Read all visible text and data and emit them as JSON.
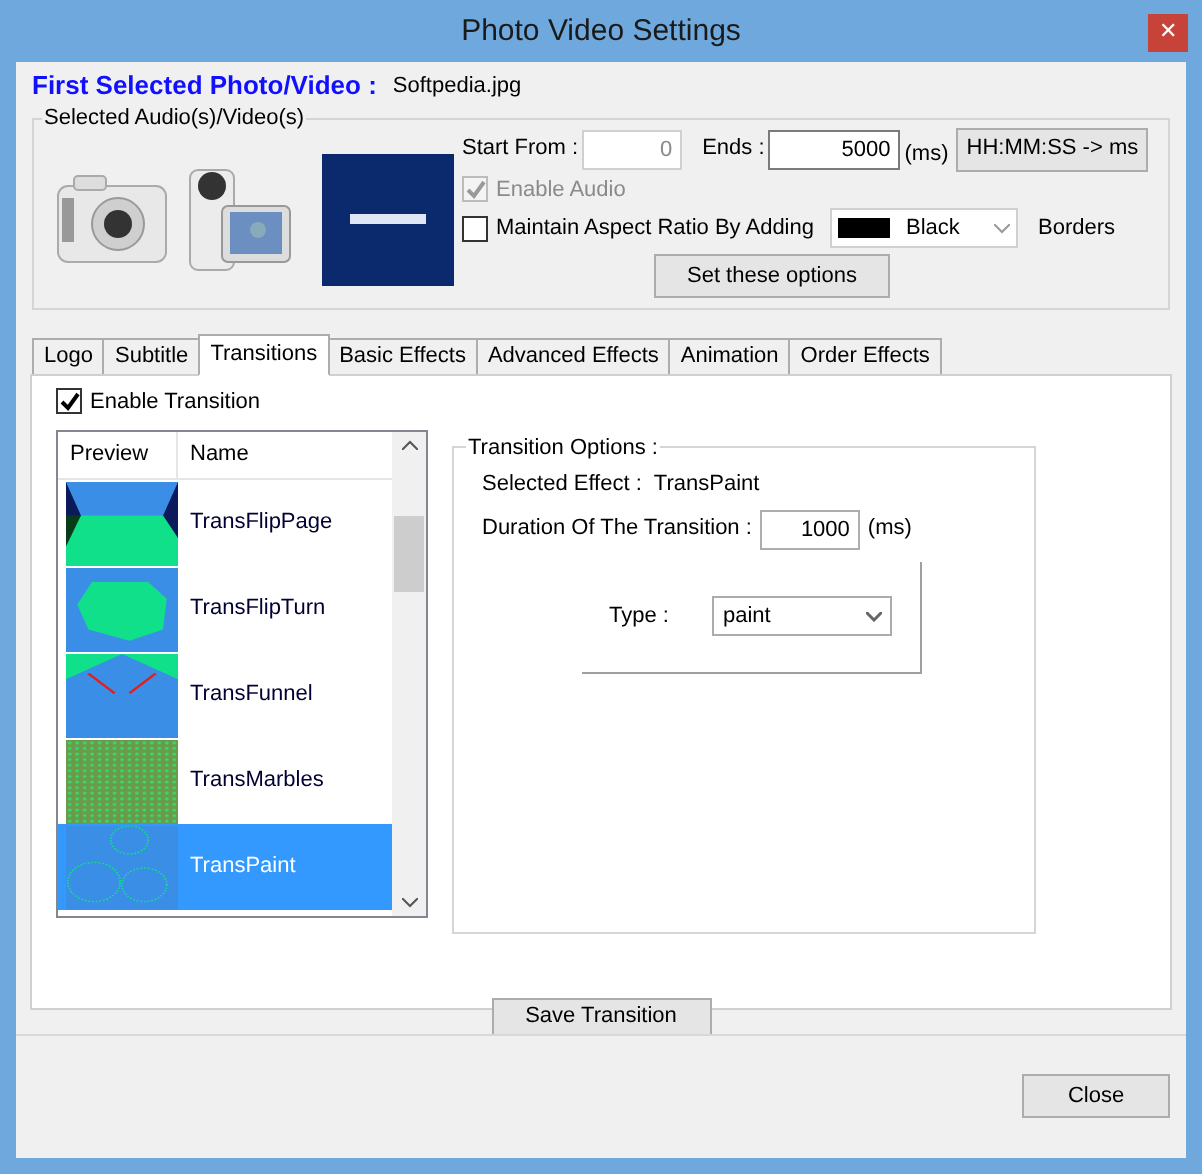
{
  "window": {
    "title": "Photo Video Settings",
    "close": "✕"
  },
  "first_selected": {
    "label": "First Selected Photo/Video :",
    "value": "Softpedia.jpg"
  },
  "media": {
    "legend": "Selected Audio(s)/Video(s)",
    "start_label": "Start From :",
    "start_value": "0",
    "start_disabled": true,
    "ends_label": "Ends :",
    "ends_value": "5000",
    "ends_unit": "(ms)",
    "convert_button": "HH:MM:SS -> ms",
    "enable_audio": {
      "label": "Enable Audio",
      "checked": true,
      "disabled": true
    },
    "aspect": {
      "label": "Maintain Aspect Ratio By Adding",
      "checked": false
    },
    "border_color": {
      "value": "Black",
      "color": "#000000"
    },
    "borders_label": "Borders",
    "set_button": "Set these options"
  },
  "tabs": [
    {
      "label": "Logo",
      "selected": false
    },
    {
      "label": "Subtitle",
      "selected": false
    },
    {
      "label": "Transitions",
      "selected": true
    },
    {
      "label": "Basic Effects",
      "selected": false
    },
    {
      "label": "Advanced Effects",
      "selected": false
    },
    {
      "label": "Animation",
      "selected": false
    },
    {
      "label": "Order Effects",
      "selected": false
    }
  ],
  "enable_transition": {
    "label": "Enable Transition",
    "checked": true
  },
  "list": {
    "columns": [
      "Preview",
      "Name"
    ],
    "rows": [
      {
        "name": "TransFlipPage",
        "kind": "flippage",
        "selected": false
      },
      {
        "name": "TransFlipTurn",
        "kind": "flipturn",
        "selected": false
      },
      {
        "name": "TransFunnel",
        "kind": "funnel",
        "selected": false
      },
      {
        "name": "TransMarbles",
        "kind": "marbles",
        "selected": false
      },
      {
        "name": "TransPaint",
        "kind": "paint",
        "selected": true
      }
    ]
  },
  "options": {
    "legend": "Transition Options :",
    "effect_label": "Selected Effect :",
    "effect_value": "TransPaint",
    "duration_label": "Duration Of The Transition :",
    "duration_value": "1000",
    "duration_unit": "(ms)",
    "type_label": "Type :",
    "type_value": "paint"
  },
  "save_button": "Save Transition",
  "close_button": "Close"
}
